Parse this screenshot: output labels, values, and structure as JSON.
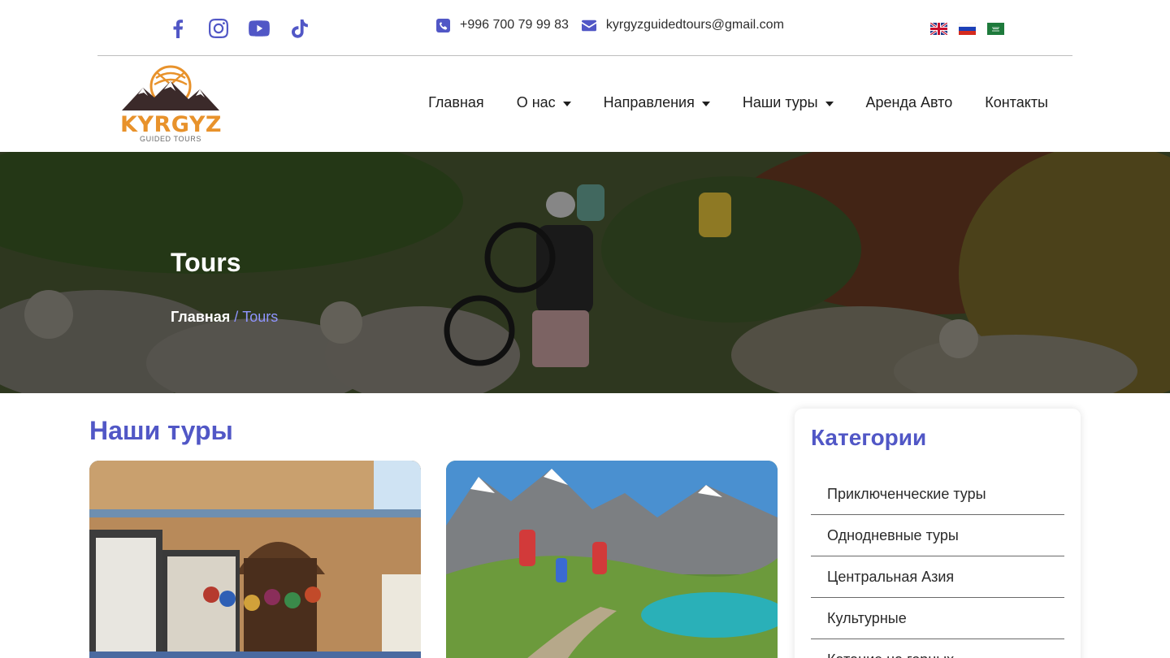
{
  "topbar": {
    "social": [
      {
        "name": "facebook-icon"
      },
      {
        "name": "instagram-icon"
      },
      {
        "name": "youtube-icon"
      },
      {
        "name": "tiktok-icon"
      }
    ],
    "phone": "+996 700 79 99 83",
    "email": "kyrgyzguidedtours@gmail.com",
    "languages": [
      "English",
      "Русский",
      "العربية"
    ]
  },
  "logo": {
    "brand": "KYRGYZ",
    "tagline": "GUIDED TOURS",
    "colors": {
      "orange": "#e8922b",
      "dark": "#3b2a2a"
    }
  },
  "nav": {
    "items": [
      {
        "label": "Главная",
        "dropdown": false
      },
      {
        "label": "О нас",
        "dropdown": true
      },
      {
        "label": "Направления",
        "dropdown": true
      },
      {
        "label": "Наши туры",
        "dropdown": true
      },
      {
        "label": "Аренда Авто",
        "dropdown": false
      },
      {
        "label": "Контакты",
        "dropdown": false
      }
    ]
  },
  "hero": {
    "title": "Tours",
    "breadcrumb": {
      "home": "Главная",
      "separator": "/",
      "current": "Tours"
    }
  },
  "main": {
    "section_title": "Наши туры"
  },
  "sidebar": {
    "title": "Категории",
    "categories": [
      "Приключенческие туры",
      "Однодневные туры",
      "Центральная Азия",
      "Культурные",
      "Катание на горных"
    ]
  },
  "colors": {
    "accent": "#5157c6",
    "breadcrumb_current": "#8f95ff",
    "text": "#222222"
  }
}
